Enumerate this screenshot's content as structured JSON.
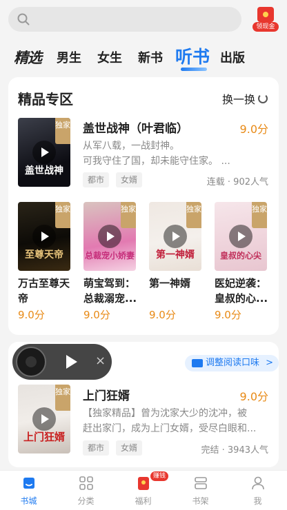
{
  "search": {
    "placeholder": ""
  },
  "reward": {
    "label": "领现金"
  },
  "tabs": [
    {
      "label": "精选"
    },
    {
      "label": "男生"
    },
    {
      "label": "女生"
    },
    {
      "label": "新书"
    },
    {
      "label": "听书"
    },
    {
      "label": "出版"
    }
  ],
  "premium": {
    "title": "精品专区",
    "refresh_label": "换一换",
    "featured": {
      "cover_title": "盖世战神",
      "exclusive": "独家",
      "title": "盖世战神（叶君临）",
      "score": "9.0分",
      "desc_line1": "从军八载，一战封神。",
      "desc_line2": "可我守住了国，却未能守住家。 ...",
      "tags": [
        "都市",
        "女婿"
      ],
      "meta": "连载 · 902人气"
    },
    "grid": [
      {
        "cover_title": "至尊天帝",
        "exclusive": "独家",
        "title": "万古至尊天帝",
        "score": "9.0分"
      },
      {
        "cover_title": "总裁宠小娇妻",
        "exclusive": "独家",
        "title": "萌宝驾到：总裁溺宠...",
        "score": "9.0分"
      },
      {
        "cover_title": "第一神婿",
        "exclusive": "独家",
        "title": "第一神婿",
        "score": "9.0分"
      },
      {
        "cover_title": "皇叔的心尖",
        "exclusive": "独家",
        "title": "医妃逆袭：皇叔的心...",
        "score": "9.0分"
      }
    ]
  },
  "player": {
    "close": "×"
  },
  "adjust": {
    "label": "调整阅读口味",
    "chevron": ">"
  },
  "second_book": {
    "cover_title": "上门狂婿",
    "exclusive": "独家",
    "title": "上门狂婿",
    "score": "9.0分",
    "desc_line1": "【独家精品】曾为沈家大少的沈冲，被",
    "desc_line2": "赶出家门，成为上门女婿，受尽白眼和...",
    "tags": [
      "都市",
      "女婿"
    ],
    "meta": "完结 · 3943人气"
  },
  "bottom_nav": [
    {
      "label": "书城"
    },
    {
      "label": "分类"
    },
    {
      "label": "福利",
      "badge": "赚钱"
    },
    {
      "label": "书架"
    },
    {
      "label": "我"
    }
  ],
  "colors": {
    "accent": "#1e7af0",
    "score": "#e88a16",
    "red": "#e8372e"
  }
}
